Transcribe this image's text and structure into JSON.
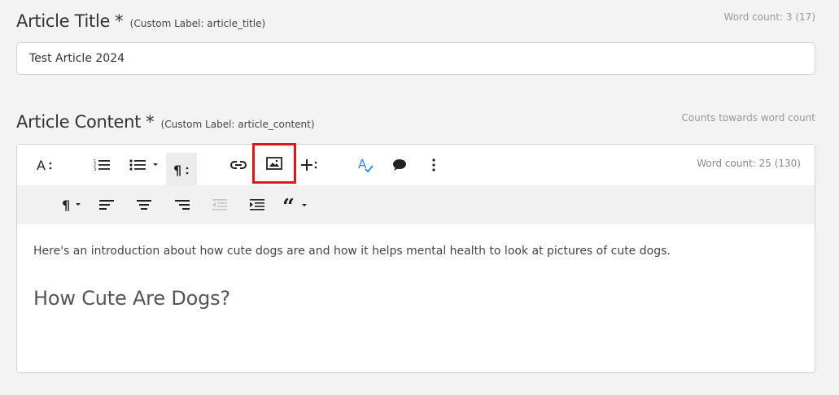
{
  "title_field": {
    "label": "Article Title",
    "required_mark": "*",
    "custom_label": "(Custom Label: article_title)",
    "word_count": "Word count: 3 (17)",
    "value": "Test Article 2024"
  },
  "content_field": {
    "label": "Article Content",
    "required_mark": "*",
    "custom_label": "(Custom Label: article_content)",
    "side_note": "Counts towards word count",
    "word_count": "Word count: 25 (130)",
    "body": {
      "paragraph": "Here's an introduction about how cute dogs are and how it helps mental health to look at pictures of cute dogs.",
      "heading": "How Cute Are Dogs?"
    }
  },
  "toolbar": {
    "row1": [
      "text-format-icon",
      "ordered-list-icon",
      "unordered-list-icon",
      "paragraph-more-icon",
      "link-icon",
      "insert-image-icon",
      "insert-more-icon",
      "spellcheck-icon",
      "comment-icon",
      "more-vertical-icon"
    ],
    "row2": [
      "paragraph-format-icon",
      "align-left-icon",
      "align-center-icon",
      "align-right-icon",
      "outdent-icon",
      "indent-icon",
      "quote-icon"
    ],
    "highlight_color": "#e0161e",
    "spellcheck_color": "#1e88e5"
  }
}
